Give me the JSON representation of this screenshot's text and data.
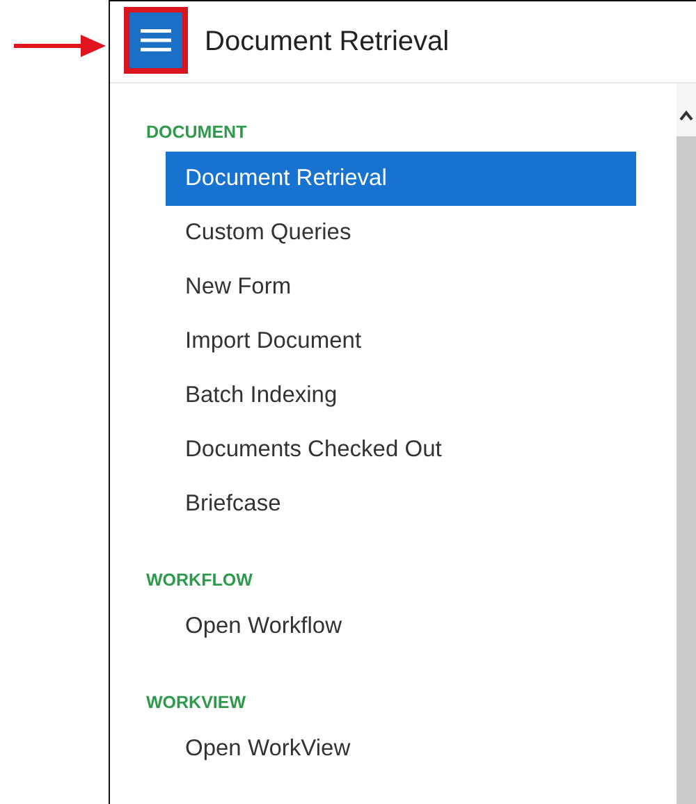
{
  "header": {
    "title": "Document Retrieval"
  },
  "sections": [
    {
      "heading": "DOCUMENT",
      "items": [
        {
          "label": "Document Retrieval",
          "selected": true
        },
        {
          "label": "Custom Queries",
          "selected": false
        },
        {
          "label": "New Form",
          "selected": false
        },
        {
          "label": "Import Document",
          "selected": false
        },
        {
          "label": "Batch Indexing",
          "selected": false
        },
        {
          "label": "Documents Checked Out",
          "selected": false
        },
        {
          "label": "Briefcase",
          "selected": false
        }
      ]
    },
    {
      "heading": "WORKFLOW",
      "items": [
        {
          "label": "Open Workflow",
          "selected": false
        }
      ]
    },
    {
      "heading": "WORKVIEW",
      "items": [
        {
          "label": "Open WorkView",
          "selected": false
        }
      ]
    }
  ]
}
